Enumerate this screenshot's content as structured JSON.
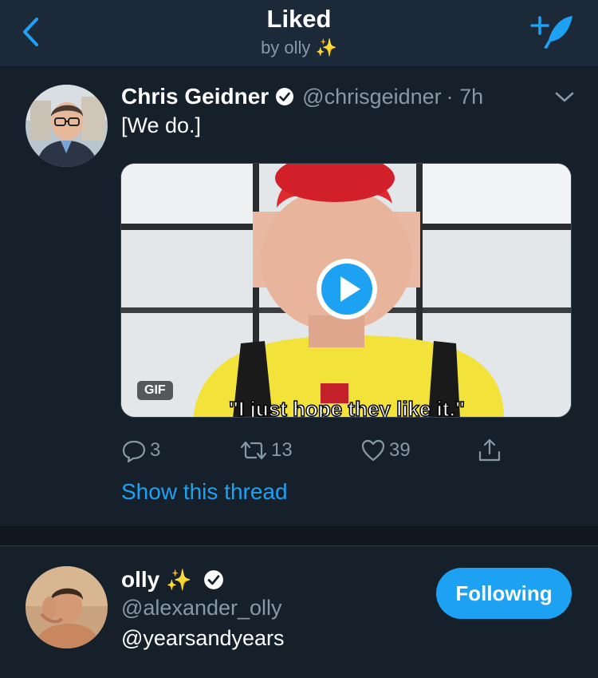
{
  "header": {
    "title": "Liked",
    "subtitle": "by olly ✨"
  },
  "tweet": {
    "author_name": "Chris Geidner",
    "author_handle": "@chrisgeidner",
    "time": "· 7h",
    "text": "[We do.]",
    "media": {
      "badge": "GIF",
      "caption": "\"I just hope they like it.\""
    },
    "actions": {
      "replies": "3",
      "retweets": "13",
      "likes": "39"
    },
    "show_thread": "Show this thread"
  },
  "profile": {
    "name": "olly",
    "sparkle": "✨",
    "handle": "@alexander_olly",
    "bio": "@yearsandyears",
    "follow_label": "Following"
  },
  "colors": {
    "accent": "#1da1f2",
    "background": "#15202b",
    "header_bg": "#1c2938",
    "secondary_text": "#8899a6"
  },
  "icons": [
    "back-icon",
    "compose-tweet-icon",
    "verified-icon",
    "chevron-down-icon",
    "play-icon",
    "reply-icon",
    "retweet-icon",
    "like-icon",
    "share-icon"
  ]
}
